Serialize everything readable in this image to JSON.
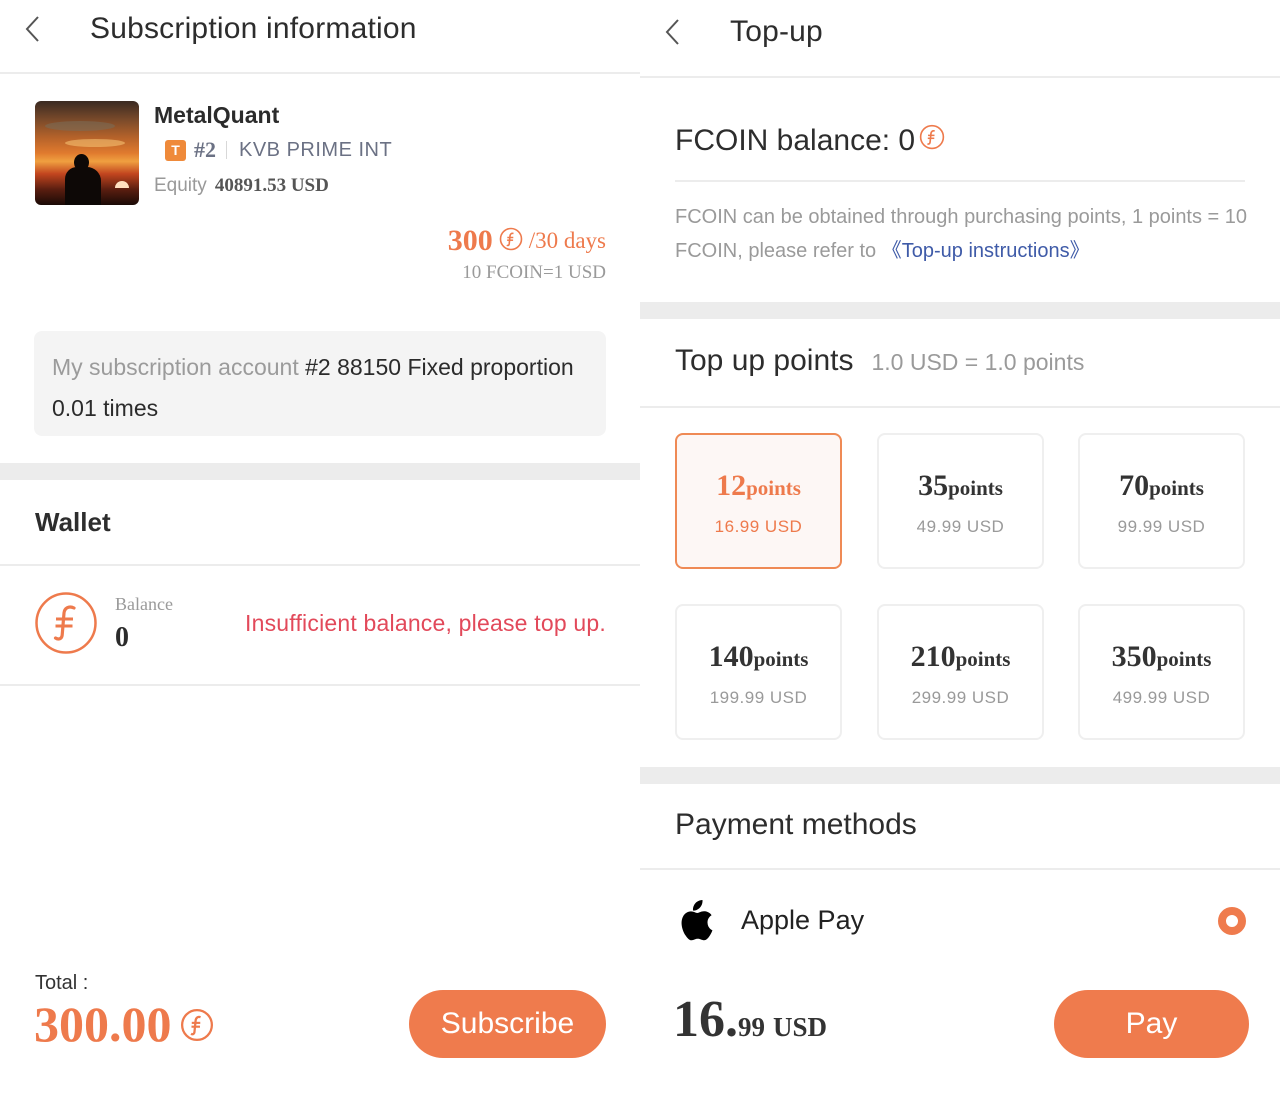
{
  "subscription": {
    "header": {
      "title": "Subscription information",
      "back_icon": "chevron-left-icon"
    },
    "signal": {
      "name": "MetalQuant",
      "badge": "T",
      "number": "#2",
      "broker": "KVB PRIME INT",
      "equity_label": "Equity",
      "equity_value": "40891.53 USD"
    },
    "price": {
      "amount": "300",
      "currency_icon": "fcoin-icon",
      "period": "/30 days",
      "rate": "10 FCOIN=1 USD"
    },
    "account": {
      "label": "My subscription account",
      "value": "#2 88150 Fixed proportion 0.01 times"
    },
    "wallet": {
      "title": "Wallet",
      "balance_label": "Balance",
      "balance_value": "0",
      "warning": "Insufficient balance, please top up."
    },
    "footer": {
      "total_label": "Total :",
      "total_value": "300.00",
      "subscribe_label": "Subscribe"
    }
  },
  "topup": {
    "header": {
      "title": "Top-up",
      "back_icon": "chevron-left-icon"
    },
    "balance_text": "FCOIN balance: 0",
    "description": "FCOIN can be obtained through purchasing points, 1 points = 10 FCOIN, please refer to ",
    "instructions_link": "《Top-up instructions》",
    "points_title": "Top up points",
    "points_rate": "1.0 USD = 1.0 points",
    "points_unit": "points",
    "packages": [
      {
        "points": "12",
        "price": "16.99  USD",
        "selected": true
      },
      {
        "points": "35",
        "price": "49.99  USD",
        "selected": false
      },
      {
        "points": "70",
        "price": "99.99  USD",
        "selected": false
      },
      {
        "points": "140",
        "price": "199.99  USD",
        "selected": false
      },
      {
        "points": "210",
        "price": "299.99  USD",
        "selected": false
      },
      {
        "points": "350",
        "price": "499.99  USD",
        "selected": false
      }
    ],
    "payment_title": "Payment methods",
    "payment_method": {
      "label": "Apple Pay",
      "icon": "apple-icon",
      "selected": true
    },
    "total": {
      "integer": "16.",
      "decimal": "99",
      "currency": "USD"
    },
    "pay_label": "Pay"
  },
  "colors": {
    "accent": "#ef7b4d",
    "warning": "#e2495a",
    "link": "#3f5ba8",
    "badge": "#ef8a3a"
  }
}
